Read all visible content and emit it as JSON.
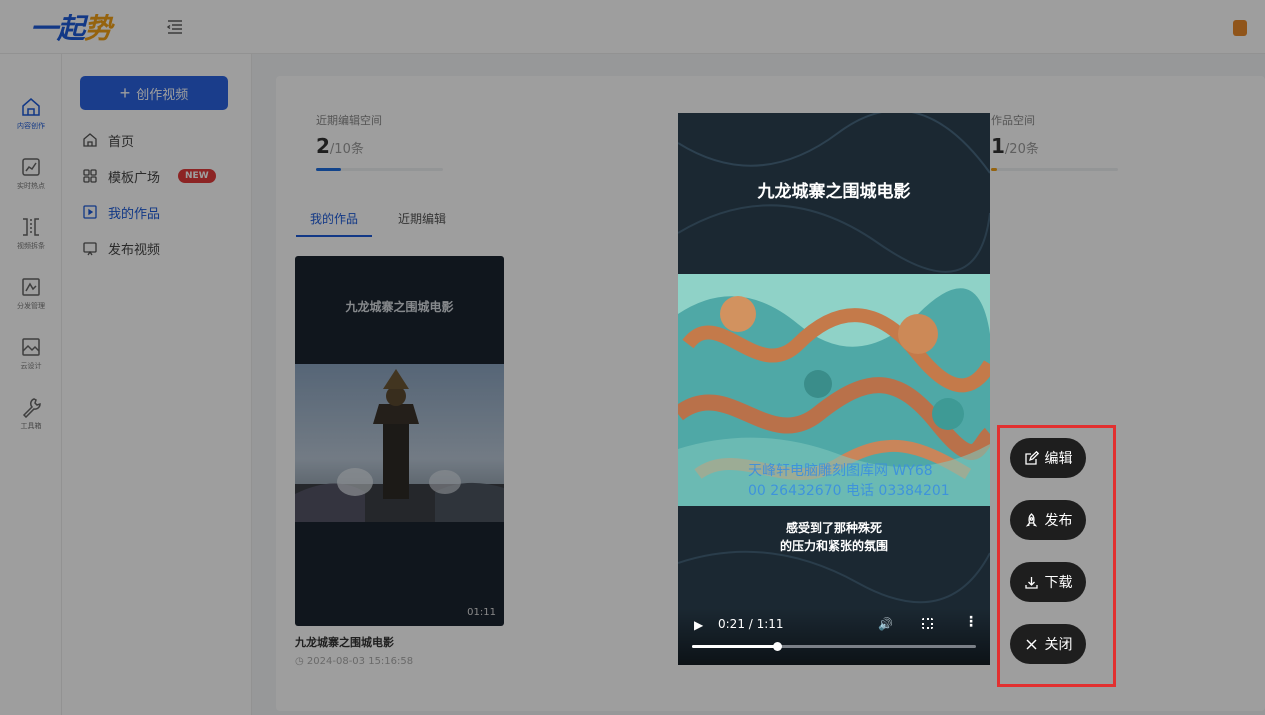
{
  "header": {
    "logo_part1": "一",
    "logo_part2": "起",
    "logo_part3": "势"
  },
  "rail": {
    "items": [
      {
        "label": "内容创作",
        "icon": "home-icon"
      },
      {
        "label": "实时热点",
        "icon": "hot-topic-icon"
      },
      {
        "label": "视频拆条",
        "icon": "split-icon"
      },
      {
        "label": "分发管理",
        "icon": "distribute-icon"
      },
      {
        "label": "云设计",
        "icon": "design-icon"
      },
      {
        "label": "工具箱",
        "icon": "wrench-icon"
      }
    ]
  },
  "sidebar": {
    "create_label": "创作视频",
    "items": [
      {
        "label": "首页"
      },
      {
        "label": "模板广场",
        "badge": "NEW"
      },
      {
        "label": "我的作品"
      },
      {
        "label": "发布视频"
      }
    ]
  },
  "stats": [
    {
      "title": "近期编辑空间",
      "value": "2",
      "total": "/10条",
      "fraction": 0.2,
      "color": "#1d6fe0"
    },
    {
      "title": "作品空间",
      "value": "1",
      "total": "/20条",
      "fraction": 0.05,
      "color": "#f0a018"
    }
  ],
  "tabs": [
    {
      "label": "我的作品"
    },
    {
      "label": "近期编辑"
    }
  ],
  "card": {
    "thumb_title": "九龙城寨之围城电影",
    "duration": "01:11",
    "name": "九龙城寨之围城电影",
    "time": "2024-08-03 15:16:58"
  },
  "player": {
    "title": "九龙城寨之围城电影",
    "watermark_line1": "天峰轩电脑雕刻图库网 WY68",
    "watermark_line2": "00 26432670  电话 03384201",
    "subtitle_line1": "感受到了那种殊死",
    "subtitle_line2": "的压力和紧张的氛围",
    "time": "0:21 / 1:11",
    "progress": 0.3
  },
  "actions": [
    {
      "label": "编辑",
      "icon": "edit-icon"
    },
    {
      "label": "发布",
      "icon": "rocket-icon"
    },
    {
      "label": "下载",
      "icon": "download-icon"
    },
    {
      "label": "关闭",
      "icon": "close-icon"
    }
  ]
}
